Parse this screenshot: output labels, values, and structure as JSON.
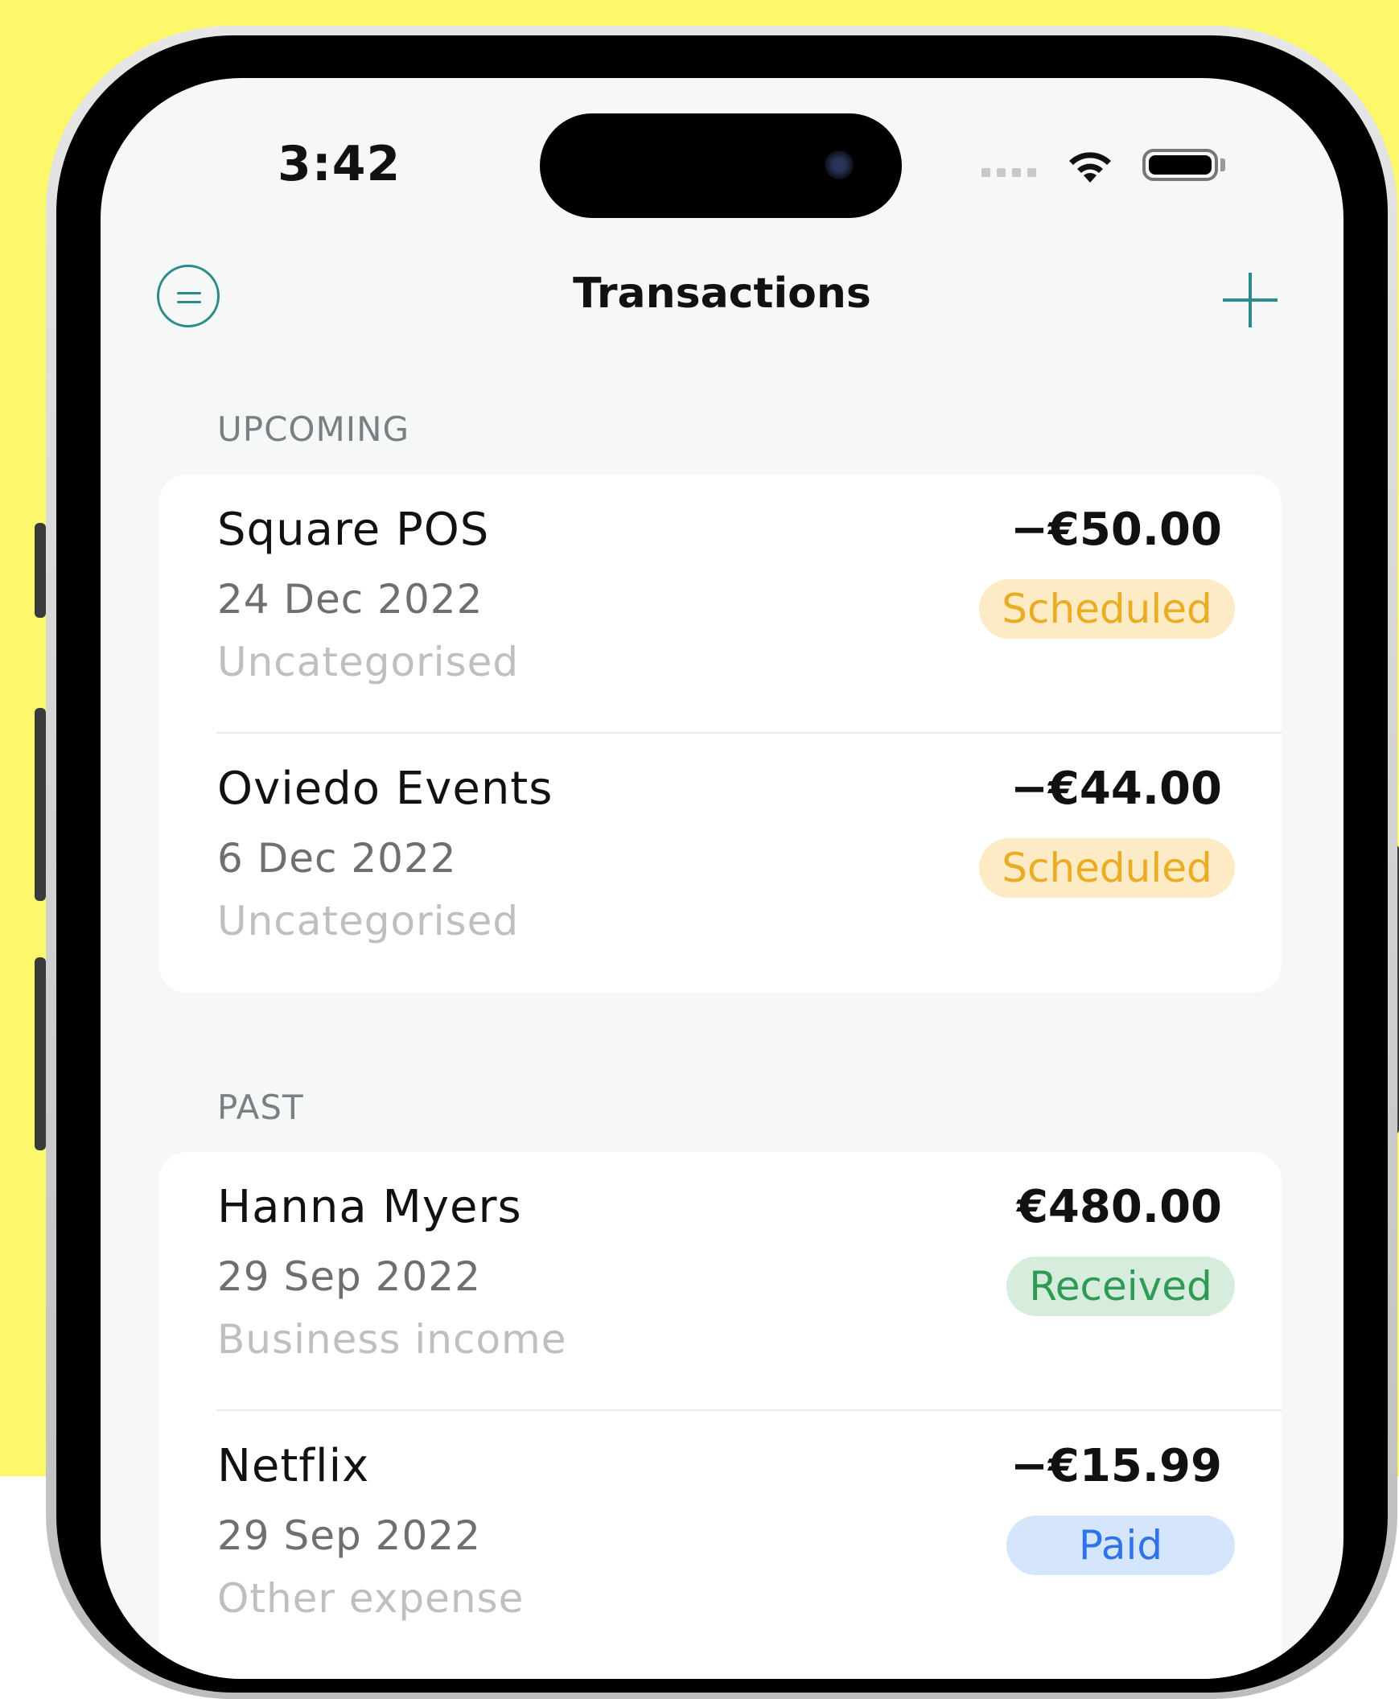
{
  "status_bar": {
    "time": "3:42"
  },
  "nav": {
    "title": "Transactions"
  },
  "sections": [
    {
      "label": "UPCOMING",
      "items": [
        {
          "name": "Square POS",
          "date": "24 Dec 2022",
          "category": "Uncategorised",
          "amount": "−€50.00",
          "status": "Scheduled"
        },
        {
          "name": "Oviedo Events",
          "date": "6 Dec 2022",
          "category": "Uncategorised",
          "amount": "−€44.00",
          "status": "Scheduled"
        }
      ]
    },
    {
      "label": "PAST",
      "items": [
        {
          "name": "Hanna Myers",
          "date": "29 Sep 2022",
          "category": "Business income",
          "amount": "€480.00",
          "status": "Received"
        },
        {
          "name": "Netflix",
          "date": "29 Sep 2022",
          "category": "Other expense",
          "amount": "−€15.99",
          "status": "Paid"
        }
      ]
    }
  ],
  "icons": {
    "filter": "filter-circle-icon",
    "add": "plus-icon",
    "wifi": "wifi-icon",
    "battery": "battery-icon",
    "signal": "cellular-signal-icon"
  },
  "colors": {
    "accent": "#2a8b88",
    "background": "#fdf76b",
    "scheduled_text": "#e9ac22",
    "scheduled_bg": "#fdebc6",
    "received_text": "#2f9a53",
    "received_bg": "#d6ecdc",
    "paid_text": "#2e74e8",
    "paid_bg": "#d5e6fc"
  }
}
